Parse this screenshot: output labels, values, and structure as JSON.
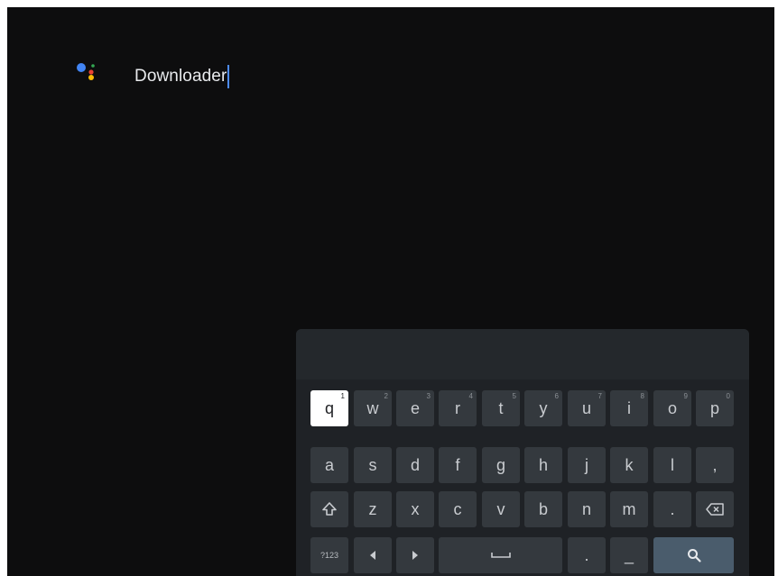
{
  "search": {
    "query": "Downloader"
  },
  "keyboard": {
    "row1": [
      {
        "label": "q",
        "hint": "1"
      },
      {
        "label": "w",
        "hint": "2"
      },
      {
        "label": "e",
        "hint": "3"
      },
      {
        "label": "r",
        "hint": "4"
      },
      {
        "label": "t",
        "hint": "5"
      },
      {
        "label": "y",
        "hint": "6"
      },
      {
        "label": "u",
        "hint": "7"
      },
      {
        "label": "i",
        "hint": "8"
      },
      {
        "label": "o",
        "hint": "9"
      },
      {
        "label": "p",
        "hint": "0"
      }
    ],
    "row2": [
      "a",
      "s",
      "d",
      "f",
      "g",
      "h",
      "j",
      "k",
      "l",
      ","
    ],
    "row3": [
      "z",
      "x",
      "c",
      "v",
      "b",
      "n",
      "m",
      "."
    ],
    "symbols_label": "?123",
    "dot_label": ".",
    "underscore_label": "_",
    "focused_key": "q"
  },
  "colors": {
    "background": "#0d0d0e",
    "keyboard": "#1f2226",
    "key": "#34393e",
    "search_key": "#4a5c6c",
    "cursor": "#4c8bf5"
  }
}
